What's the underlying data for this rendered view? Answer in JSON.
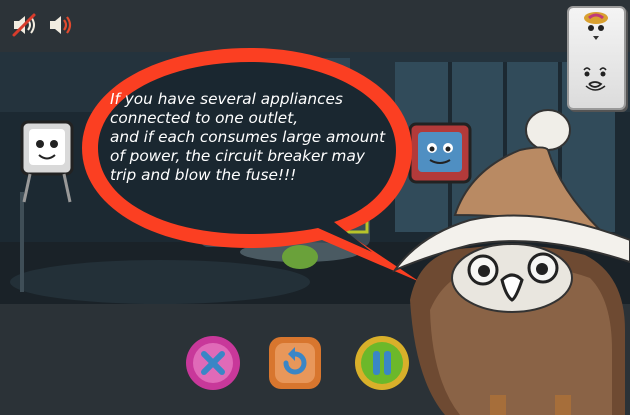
{
  "toolbar": {
    "mute_icon": "speaker-muted-icon",
    "sound_icon": "speaker-on-icon"
  },
  "speech": {
    "lines": [
      "If you have several appliances",
      "connected to one outlet,",
      "and if each consumes large amount",
      "of power, the circuit breaker may",
      "trip and blow the fuse!!!"
    ]
  },
  "controls": {
    "close_icon": "close-x-icon",
    "replay_icon": "replay-icon",
    "pause_icon": "pause-icon"
  },
  "colors": {
    "bubble_red": "#f25a3c",
    "close_pink": "#c8389a",
    "replay_orange": "#d8762e",
    "pause_green": "#6cb82a",
    "icon_blue": "#3a86c6"
  }
}
